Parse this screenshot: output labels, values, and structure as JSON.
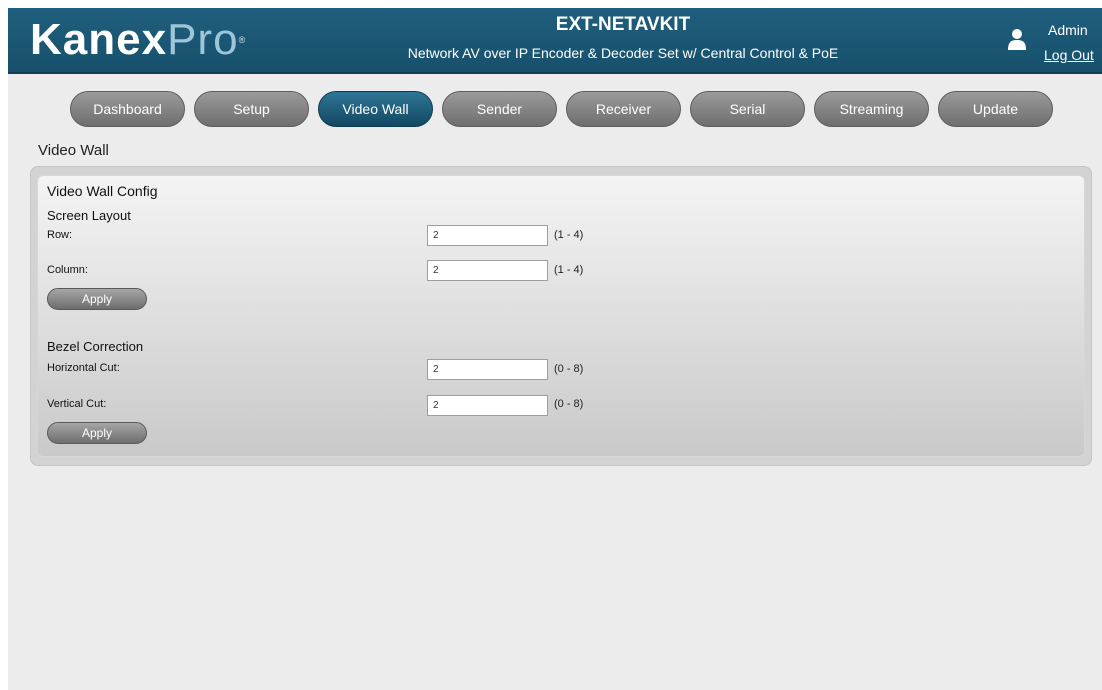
{
  "header": {
    "logo_bold": "Kanex",
    "logo_light": "Pro",
    "logo_mark": "®",
    "product_title": "EXT-NETAVKIT",
    "product_subtitle": "Network AV over IP Encoder & Decoder Set w/ Central Control & PoE",
    "user_name": "Admin",
    "logout_label": "Log Out"
  },
  "nav": {
    "tabs": [
      {
        "label": "Dashboard",
        "active": false
      },
      {
        "label": "Setup",
        "active": false
      },
      {
        "label": "Video Wall",
        "active": true
      },
      {
        "label": "Sender",
        "active": false
      },
      {
        "label": "Receiver",
        "active": false
      },
      {
        "label": "Serial",
        "active": false
      },
      {
        "label": "Streaming",
        "active": false
      },
      {
        "label": "Update",
        "active": false
      }
    ]
  },
  "page_title": "Video Wall",
  "config": {
    "title": "Video Wall Config",
    "screen_layout": {
      "title": "Screen Layout",
      "row_label": "Row:",
      "row_value": "2",
      "row_range": "(1 - 4)",
      "column_label": "Column:",
      "column_value": "2",
      "column_range": "(1 - 4)",
      "apply_label": "Apply"
    },
    "bezel": {
      "title": "Bezel Correction",
      "horizontal_label": "Horizontal Cut:",
      "horizontal_value": "2",
      "horizontal_range": "(0 - 8)",
      "vertical_label": "Vertical Cut:",
      "vertical_value": "2",
      "vertical_range": "(0 - 8)",
      "apply_label": "Apply"
    }
  },
  "colors": {
    "header_bg": "#1f5f7d",
    "nav_active": "#1b5b7a",
    "nav_inactive": "#858585",
    "page_bg": "#ececec"
  },
  "icons": {
    "user": "user-icon"
  }
}
